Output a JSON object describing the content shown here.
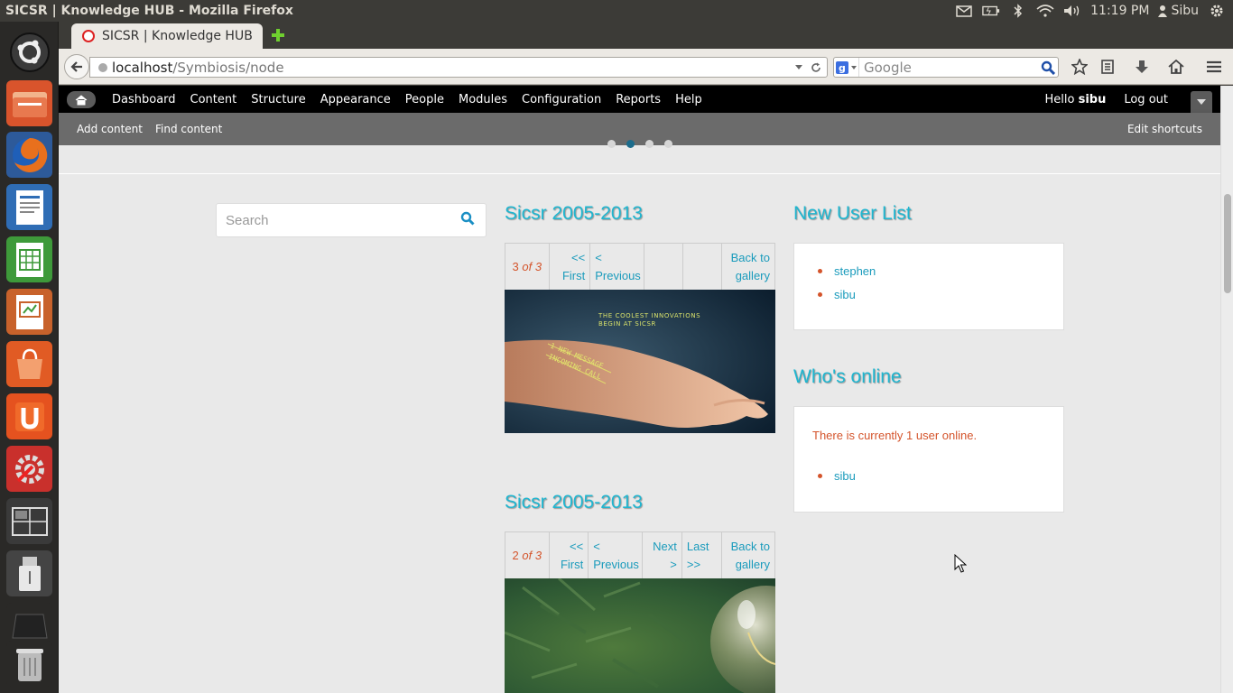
{
  "system": {
    "window_title": "SICSR | Knowledge HUB - Mozilla Firefox",
    "clock": "11:19 PM",
    "user": "Sibu"
  },
  "browser": {
    "tab_title": "SICSR | Knowledge HUB",
    "url_host": "localhost",
    "url_path": "/Symbiosis/node",
    "search_placeholder": "Google"
  },
  "toolbar": {
    "menu": [
      "Dashboard",
      "Content",
      "Structure",
      "Appearance",
      "People",
      "Modules",
      "Configuration",
      "Reports",
      "Help"
    ],
    "hello": "Hello",
    "username": "sibu",
    "logout": "Log out"
  },
  "shortcuts": {
    "add_content": "Add content",
    "find_content": "Find content",
    "edit_shortcuts": "Edit shortcuts"
  },
  "search": {
    "placeholder": "Search"
  },
  "galleries": [
    {
      "title": "Sicsr 2005-2013",
      "count_current": "3",
      "count_of": "of",
      "count_total": "3",
      "first": [
        "<<",
        "First"
      ],
      "previous": [
        "<",
        "Previous"
      ],
      "back": [
        "Back to",
        "gallery"
      ],
      "image_caption": [
        "THE COOLEST INNOVATIONS",
        "BEGIN AT SICSR"
      ],
      "image_overlay": [
        "1 NEW MESSAGE",
        "INCOMING CALL"
      ]
    },
    {
      "title": "Sicsr 2005-2013",
      "count_current": "2",
      "count_of": "of",
      "count_total": "3",
      "first": [
        "<<",
        "First"
      ],
      "previous": [
        "<",
        "Previous"
      ],
      "next": [
        "Next",
        ">"
      ],
      "last": [
        "Last",
        ">>"
      ],
      "back": [
        "Back to",
        "gallery"
      ]
    }
  ],
  "new_users": {
    "title": "New User List",
    "users": [
      "stephen",
      "sibu"
    ]
  },
  "whos_online": {
    "title": "Who's online",
    "status": "There is currently 1 user online.",
    "users": [
      "sibu"
    ]
  },
  "colors": {
    "link": "#1a9bbc",
    "title": "#1fb6d0",
    "accent": "#d4542b"
  }
}
